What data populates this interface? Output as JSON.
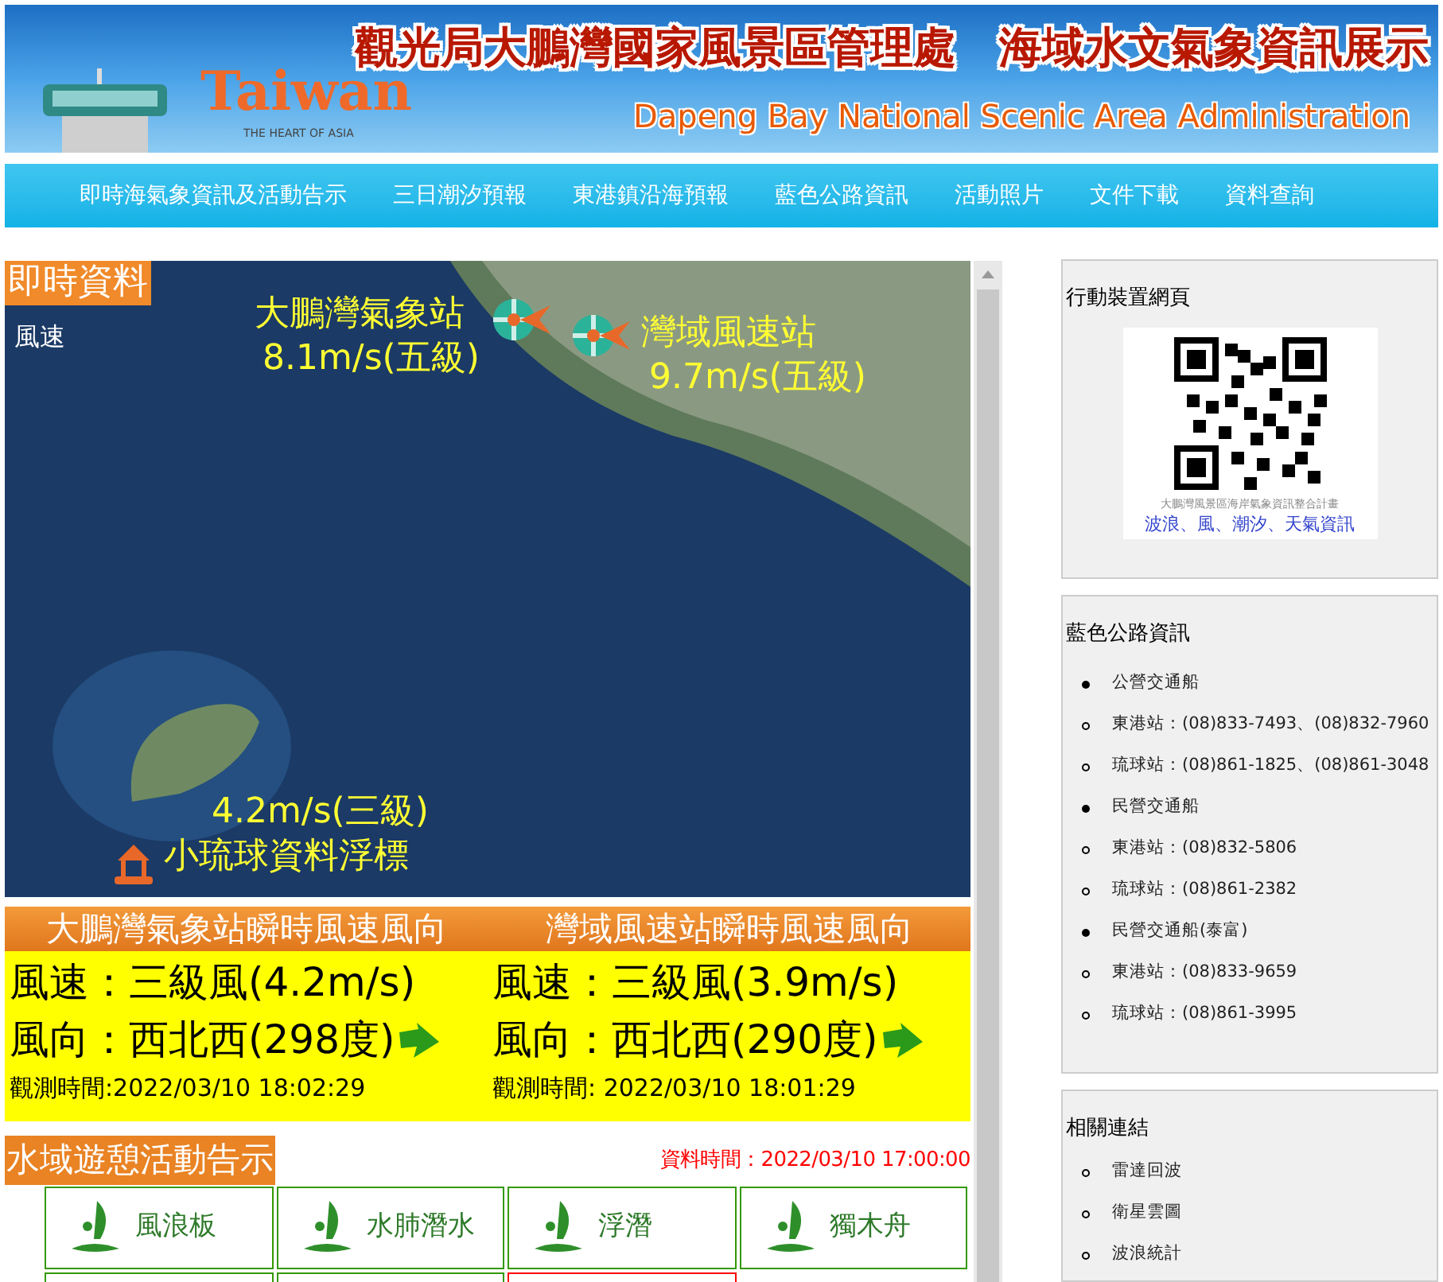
{
  "banner": {
    "logo": "Taiwan",
    "tagline": "THE HEART OF ASIA",
    "title": "觀光局大鵬灣國家風景區管理處　海域水文氣象資訊展示",
    "subtitle": "Dapeng Bay National Scenic Area Administration"
  },
  "nav": [
    "即時海氣象資訊及活動告示",
    "三日潮汐預報",
    "東港鎮沿海預報",
    "藍色公路資訊",
    "活動照片",
    "文件下載",
    "資料查詢"
  ],
  "realtime": {
    "heading": "即時資料",
    "layer": "風速",
    "stations": [
      {
        "kind": "wind",
        "name": "大鵬灣氣象站",
        "reading": "8.1m/s(五級)"
      },
      {
        "kind": "wind",
        "name": "灣域風速站",
        "reading": "9.7m/s(五級)"
      },
      {
        "kind": "buoy",
        "name": "小琉球資料浮標",
        "reading": "4.2m/s(三級)"
      }
    ]
  },
  "instant": [
    {
      "title": "大鵬灣氣象站瞬時風速風向",
      "speed": "風速：三級風(4.2m/s)",
      "direction": "風向：西北西(298度)",
      "time": "觀測時間:2022/03/10 18:02:29"
    },
    {
      "title": "灣域風速站瞬時風速風向",
      "speed": "風速：三級風(3.9m/s)",
      "direction": "風向：西北西(290度)",
      "time": "觀測時間: 2022/03/10 18:01:29"
    }
  ],
  "activities": {
    "heading": "水域遊憩活動告示",
    "data_time": "資料時間：2022/03/10 17:00:00",
    "items": [
      {
        "label": "風浪板",
        "color": "#339900"
      },
      {
        "label": "水肺潛水",
        "color": "#339900"
      },
      {
        "label": "浮潛",
        "color": "#339900"
      },
      {
        "label": "獨木舟",
        "color": "#339900"
      },
      {
        "color": "#339900"
      },
      {
        "color": "#339900"
      },
      {
        "color": "#ff0000"
      }
    ]
  },
  "sidebar": {
    "mobile": {
      "title": "行動裝置網頁",
      "qr_caption": "大鵬灣風景區海岸氣象資訊整合計畫",
      "qr_subcaption": "波浪、風、潮汐、天氣資訊"
    },
    "blue_highway": {
      "title": "藍色公路資訊",
      "items": [
        {
          "label": "公營交通船",
          "children": [
            {
              "label": "東港站：(08)833-7493、(08)832-7960"
            },
            {
              "label": "琉球站：(08)861-1825、(08)861-3048"
            }
          ]
        },
        {
          "label": "民營交通船",
          "children": [
            {
              "label": "東港站：(08)832-5806"
            },
            {
              "label": "琉球站：(08)861-2382"
            }
          ]
        },
        {
          "label": "民營交通船(泰富)",
          "children": [
            {
              "label": "東港站：(08)833-9659"
            },
            {
              "label": "琉球站：(08)861-3995"
            }
          ]
        }
      ]
    },
    "links": {
      "title": "相關連結",
      "items": [
        {
          "label": "雷達回波"
        },
        {
          "label": "衛星雲圖"
        },
        {
          "label": "波浪統計"
        }
      ]
    }
  }
}
